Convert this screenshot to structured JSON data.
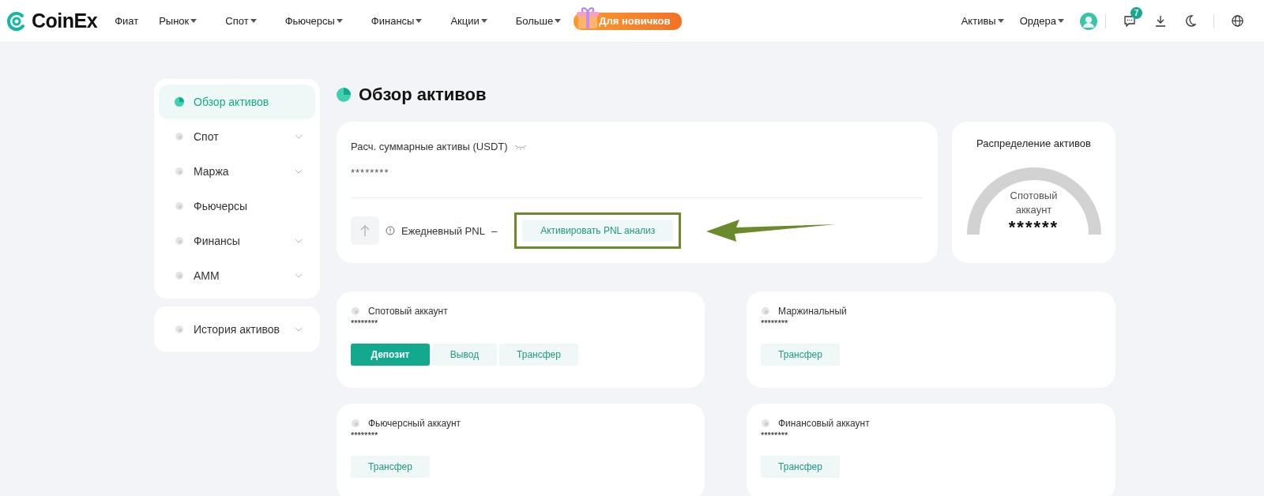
{
  "header": {
    "logo": "CoinEx",
    "nav": [
      {
        "label": "Фиат",
        "dropdown": false
      },
      {
        "label": "Рынок",
        "dropdown": true
      },
      {
        "label": "Спот",
        "dropdown": true
      },
      {
        "label": "Фьючерсы",
        "dropdown": true
      },
      {
        "label": "Финансы",
        "dropdown": true
      },
      {
        "label": "Акции",
        "dropdown": true
      },
      {
        "label": "Больше",
        "dropdown": true
      }
    ],
    "promo": "Для новичков",
    "right_nav": [
      {
        "label": "Активы",
        "dropdown": true
      },
      {
        "label": "Ордера",
        "dropdown": true
      }
    ],
    "messages_badge": "7"
  },
  "sidebar": {
    "items": [
      {
        "label": "Обзор активов",
        "selected": true,
        "expandable": false
      },
      {
        "label": "Спот",
        "selected": false,
        "expandable": true
      },
      {
        "label": "Маржа",
        "selected": false,
        "expandable": true
      },
      {
        "label": "Фьючерсы",
        "selected": false,
        "expandable": false
      },
      {
        "label": "Финансы",
        "selected": false,
        "expandable": true
      },
      {
        "label": "AMM",
        "selected": false,
        "expandable": true
      }
    ],
    "history": {
      "label": "История активов",
      "expandable": true
    }
  },
  "title": "Обзор активов",
  "summary": {
    "label": "Расч. суммарные активы (USDT)",
    "value": "********",
    "pnl_label": "Ежедневный PNL",
    "pnl_value": "–",
    "activate_button": "Активировать PNL анализ"
  },
  "distribution": {
    "title": "Распределение активов",
    "center_label": "Спотовый аккаунт",
    "center_value": "******"
  },
  "accounts": [
    {
      "name": "Спотовый аккаунт",
      "value": "********",
      "buttons": [
        {
          "label": "Депозит",
          "kind": "primary"
        },
        {
          "label": "Вывод",
          "kind": "secondary"
        },
        {
          "label": "Трансфер",
          "kind": "secondary"
        }
      ]
    },
    {
      "name": "Маржинальный",
      "value": "********",
      "buttons": [
        {
          "label": "Трансфер",
          "kind": "secondary"
        }
      ]
    },
    {
      "name": "Фьючерсный аккаунт",
      "value": "********",
      "buttons": [
        {
          "label": "Трансфер",
          "kind": "secondary"
        }
      ]
    },
    {
      "name": "Финансовый аккаунт",
      "value": "********",
      "buttons": [
        {
          "label": "Трансфер",
          "kind": "secondary"
        }
      ]
    }
  ]
}
